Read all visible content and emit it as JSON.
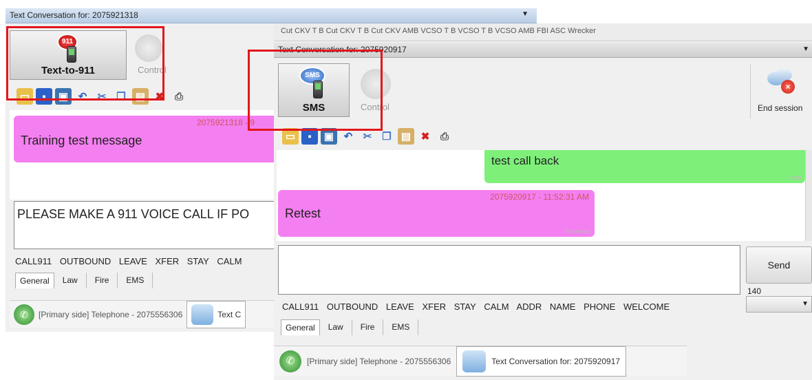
{
  "left_window": {
    "title": "Text Conversation for: 2075921318",
    "big_button": "Text-to-911",
    "big_icon_text": "911",
    "control_label": "Control",
    "message": {
      "meta": "2075921318 - 9",
      "text": "Training test message"
    },
    "input_value": "PLEASE MAKE A 911 VOICE CALL IF PO",
    "quick_texts": [
      "CALL911",
      "OUTBOUND",
      "LEAVE",
      "XFER",
      "STAY",
      "CALM"
    ],
    "tabs": [
      "General",
      "Law",
      "Fire",
      "EMS"
    ],
    "status_primary": "[Primary side] Telephone - 2075556306",
    "status_text_tab": "Text C"
  },
  "right_window": {
    "header_fragment": "Cut CKV T B  Cut CKV T B  Cut CKV AMB  VCSO T B  VCSO T B  VCSO AMB  FBI  ASC  Wrecker",
    "title": "Text Conversation for: 2075920917",
    "big_button": "SMS",
    "big_icon_text": "SMS",
    "control_label": "Control",
    "end_session": "End session",
    "sent_message": {
      "text": "test call back",
      "status": "sent"
    },
    "received_message": {
      "meta": "2075920917 - 11:52:31 AM",
      "text": "Retest",
      "status": "Received"
    },
    "send_label": "Send",
    "char_count": "140",
    "quick_texts": [
      "CALL911",
      "OUTBOUND",
      "LEAVE",
      "XFER",
      "STAY",
      "CALM",
      "ADDR",
      "NAME",
      "PHONE",
      "WELCOME"
    ],
    "tabs": [
      "General",
      "Law",
      "Fire",
      "EMS"
    ],
    "status_primary": "[Primary side] Telephone - 2075556306",
    "status_text_tab": "Text Conversation for: 2075920917"
  },
  "colors": {
    "highlight_red": "#e3161b",
    "received_bubble": "#f47ff0",
    "sent_bubble": "#7ef07a",
    "titlebar_blue": "#c9d9ee"
  }
}
